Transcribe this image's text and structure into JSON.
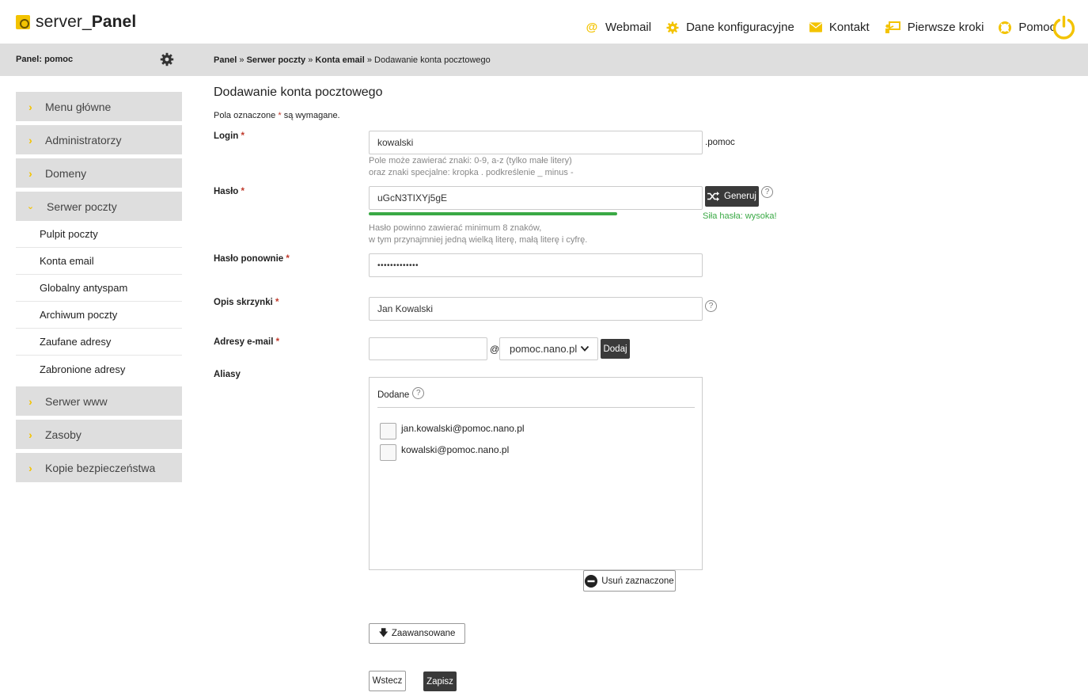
{
  "header": {
    "logo_server": "server_",
    "logo_panel": "Panel",
    "nav": [
      {
        "label": "Webmail",
        "icon": "at-icon"
      },
      {
        "label": "Dane konfiguracyjne",
        "icon": "gear-icon"
      },
      {
        "label": "Kontakt",
        "icon": "envelope-icon"
      },
      {
        "label": "Pierwsze kroki",
        "icon": "presentation-icon"
      },
      {
        "label": "Pomoc",
        "icon": "lifebuoy-icon"
      }
    ],
    "accent_color": "#f3c300"
  },
  "subheader": {
    "panel_label": "Panel: pomoc",
    "breadcrumb": {
      "crumb1": "Panel",
      "crumb2": "Serwer poczty",
      "crumb3": "Konta email",
      "current": "Dodawanie konta pocztowego"
    }
  },
  "sidebar": {
    "items": [
      {
        "label": "Menu główne"
      },
      {
        "label": "Administratorzy"
      },
      {
        "label": "Domeny"
      },
      {
        "label": "Serwer poczty"
      },
      {
        "label": "Serwer www"
      },
      {
        "label": "Zasoby"
      },
      {
        "label": "Kopie bezpieczeństwa"
      }
    ],
    "subitems": [
      {
        "label": "Pulpit poczty"
      },
      {
        "label": "Konta email"
      },
      {
        "label": "Globalny antyspam"
      },
      {
        "label": "Archiwum poczty"
      },
      {
        "label": "Zaufane adresy"
      },
      {
        "label": "Zabronione adresy"
      }
    ]
  },
  "form": {
    "title": "Dodawanie konta pocztowego",
    "required_note_pre": "Pola oznaczone",
    "required_star": "*",
    "required_note_post": "są wymagane.",
    "login": {
      "label": "Login",
      "value": "kowalski",
      "suffix": ".pomoc",
      "hint1": "Pole może zawierać znaki: 0-9, a-z (tylko małe litery)",
      "hint2": "oraz znaki specjalne: kropka . podkreślenie _ minus -"
    },
    "password": {
      "label": "Hasło",
      "value": "uGcN3TIXYj5gE",
      "generate_label": "Generuj",
      "strength_label": "Siła hasła: wysoka!",
      "strength_fraction": 1.0,
      "hint1": "Hasło powinno zawierać minimum 8 znaków,",
      "hint2": "w tym przynajmniej jedną wielką literę, małą literę i cyfrę."
    },
    "password_repeat": {
      "label": "Hasło ponownie",
      "value": "•••••••••••••"
    },
    "mailbox_desc": {
      "label": "Opis skrzynki",
      "value": "Jan Kowalski"
    },
    "email_addresses": {
      "label": "Adresy e-mail",
      "value": "",
      "at": "@",
      "domain": "pomoc.nano.pl",
      "add_label": "Dodaj"
    },
    "aliases": {
      "label": "Aliasy",
      "added_label": "Dodane",
      "items": [
        {
          "address": "jan.kowalski@pomoc.nano.pl"
        },
        {
          "address": "kowalski@pomoc.nano.pl"
        }
      ],
      "remove_label": "Usuń zaznaczone"
    },
    "advanced_label": "Zaawansowane",
    "back_label": "Wstecz",
    "save_label": "Zapisz"
  }
}
